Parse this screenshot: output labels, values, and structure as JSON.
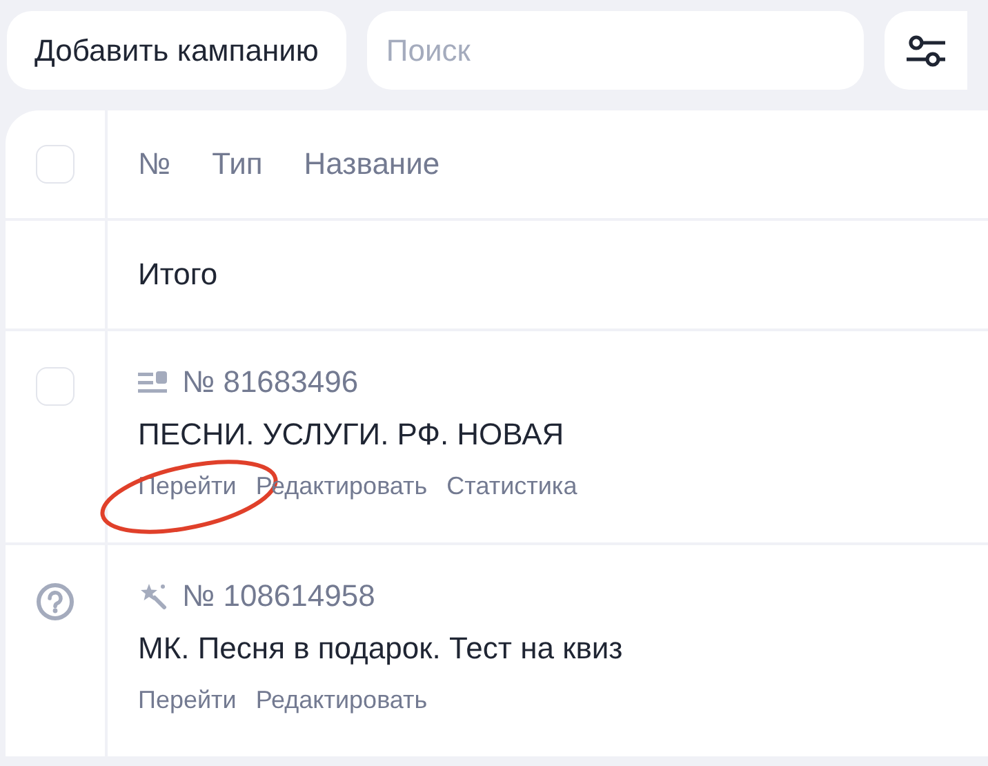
{
  "toolbar": {
    "add_button": "Добавить кампанию",
    "search": {
      "placeholder": "Поиск"
    }
  },
  "table": {
    "header": {
      "checked": false,
      "columns": [
        "№",
        "Тип",
        "Название"
      ]
    },
    "total_label": "Итого",
    "rows": [
      {
        "kind": "checkbox",
        "checked": false,
        "type_icon": {
          "kind": "text-lines"
        },
        "number": "№ 81683496",
        "name": "ПЕСНИ. УСЛУГИ. РФ. НОВАЯ",
        "links": [
          {
            "label": "Перейти",
            "circled": true
          },
          {
            "label": "Редактировать",
            "circled": false
          },
          {
            "label": "Статистика",
            "circled": false
          }
        ]
      },
      {
        "kind": "help",
        "type_icon": {
          "kind": "magic-wand"
        },
        "number": "№ 108614958",
        "name": "МК. Песня в подарок. Тест на квиз",
        "links": [
          {
            "label": "Перейти",
            "circled": false
          },
          {
            "label": "Редактировать",
            "circled": false
          }
        ]
      }
    ]
  }
}
